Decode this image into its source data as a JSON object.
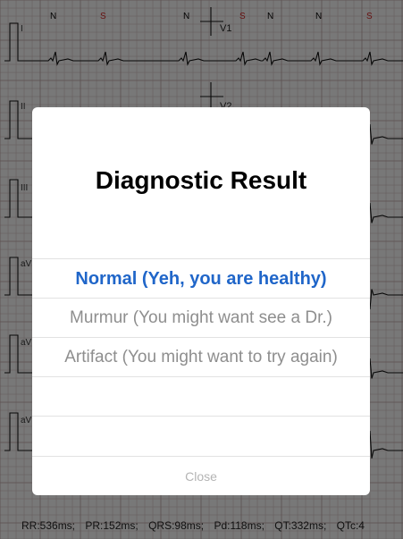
{
  "ecg": {
    "beat_labels": [
      "N",
      "S",
      "N",
      "S",
      "N",
      "N",
      "S",
      "N"
    ],
    "lead_labels": [
      "I",
      "II",
      "III",
      "aVR",
      "aVL",
      "aVF"
    ],
    "lead_labels_visible": [
      "I",
      "II",
      "III",
      "aV",
      "aV",
      "aV"
    ],
    "v_labels": [
      "V1",
      "V2"
    ],
    "intervals": [
      "RR:536ms;",
      "PR:152ms;",
      "QRS:98ms;",
      "Pd:118ms;",
      "QT:332ms;",
      "QTc:4"
    ]
  },
  "dialog": {
    "title": "Diagnostic Result",
    "options": [
      "Normal (Yeh, you are healthy)",
      "Murmur (You might want see a Dr.)",
      "Artifact (You might want to try again)",
      "",
      ""
    ],
    "close_label": "Close"
  },
  "colors": {
    "primary_option": "#2066c9",
    "secondary_option": "#8e8e8e",
    "beat_normal": "#000000",
    "beat_supraventricular": "#cc2222",
    "grid": "#b9a9a9"
  }
}
